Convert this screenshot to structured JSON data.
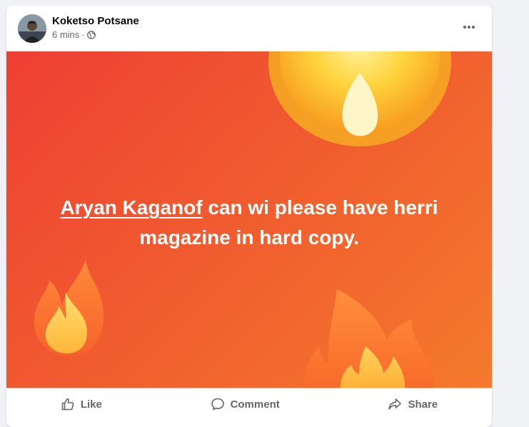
{
  "post": {
    "author": "Koketso Potsane",
    "time": "6 mins",
    "separator": "·",
    "privacy_icon": "globe-icon",
    "more_icon": "more-options-icon",
    "mention": "Aryan Kaganof",
    "text_after_mention": " can wi please have herri magazine in hard copy.",
    "background": {
      "gradient_start": "#ee3f34",
      "gradient_end": "#f47a2c",
      "decoration": "fire-emoji"
    }
  },
  "actions": {
    "like_label": "Like",
    "comment_label": "Comment",
    "share_label": "Share"
  },
  "colors": {
    "secondary_text": "#65676b",
    "card_bg": "#ffffff",
    "page_bg": "#f0f2f5"
  }
}
